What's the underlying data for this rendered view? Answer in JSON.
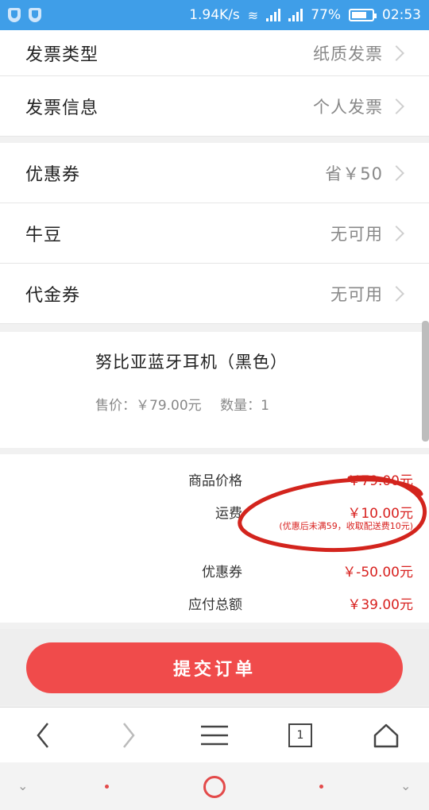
{
  "status_bar": {
    "speed": "1.94K/s",
    "battery_pct": "77%",
    "battery_level": 0.77,
    "time": "02:53"
  },
  "invoice": {
    "type_label": "发票类型",
    "type_value": "纸质发票",
    "info_label": "发票信息",
    "info_value": "个人发票"
  },
  "discounts": {
    "coupon_label": "优惠券",
    "coupon_value": "省￥50",
    "beans_label": "牛豆",
    "beans_value": "无可用",
    "voucher_label": "代金券",
    "voucher_value": "无可用"
  },
  "product": {
    "name": "努比亚蓝牙耳机（黑色）",
    "price": "售价：￥79.00元",
    "qty": "数量：1"
  },
  "summary": {
    "goods_label": "商品价格",
    "goods_value": "￥79.00元",
    "shipping_label": "运费",
    "shipping_value": "￥10.00元",
    "shipping_note": "(优惠后未满59，收取配送费10元)",
    "coupon_label": "优惠券",
    "coupon_value": "￥-50.00元",
    "total_label": "应付总额",
    "total_value": "￥39.00元"
  },
  "submit_label": "提交订单",
  "browser": {
    "tab_count": "1",
    "icons": [
      "back-icon",
      "forward-icon",
      "menu-icon",
      "tabs-icon",
      "home-icon"
    ]
  },
  "colors": {
    "status_bar": "#3f9ee8",
    "accent_red": "#d8211f",
    "submit_button": "#f04b4b"
  }
}
